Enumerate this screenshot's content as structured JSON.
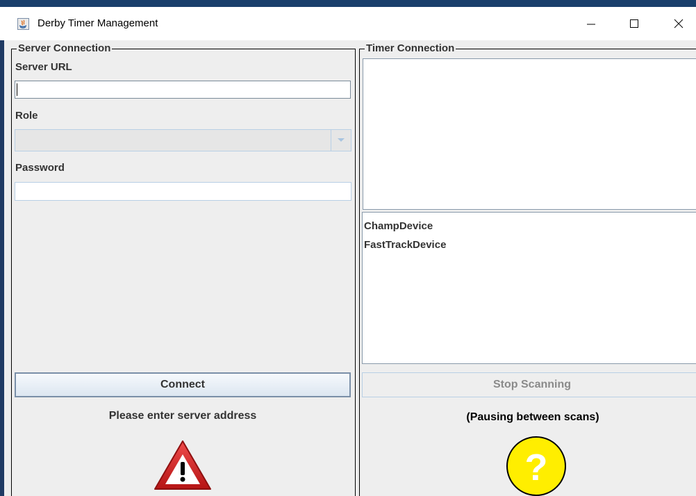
{
  "window": {
    "title": "Derby Timer Management",
    "controls": {
      "minimize_glyph": "—",
      "maximize_glyph": "☐",
      "close_glyph": "✕"
    }
  },
  "server": {
    "group_title": "Server Connection",
    "url_label": "Server URL",
    "url_value": "",
    "role_label": "Role",
    "role_value": "",
    "password_label": "Password",
    "password_value": "",
    "connect_label": "Connect",
    "status": "Please enter server address",
    "status_icon": "warning-triangle-icon"
  },
  "timer": {
    "group_title": "Timer Connection",
    "devices": [
      "ChampDevice",
      "FastTrackDevice"
    ],
    "stop_label": "Stop Scanning",
    "status": "(Pausing between scans)",
    "status_icon": "question-circle-icon"
  },
  "colors": {
    "warning_red": "#d42020",
    "question_yellow": "#ffee00",
    "title_border": "#1a3f6b"
  }
}
